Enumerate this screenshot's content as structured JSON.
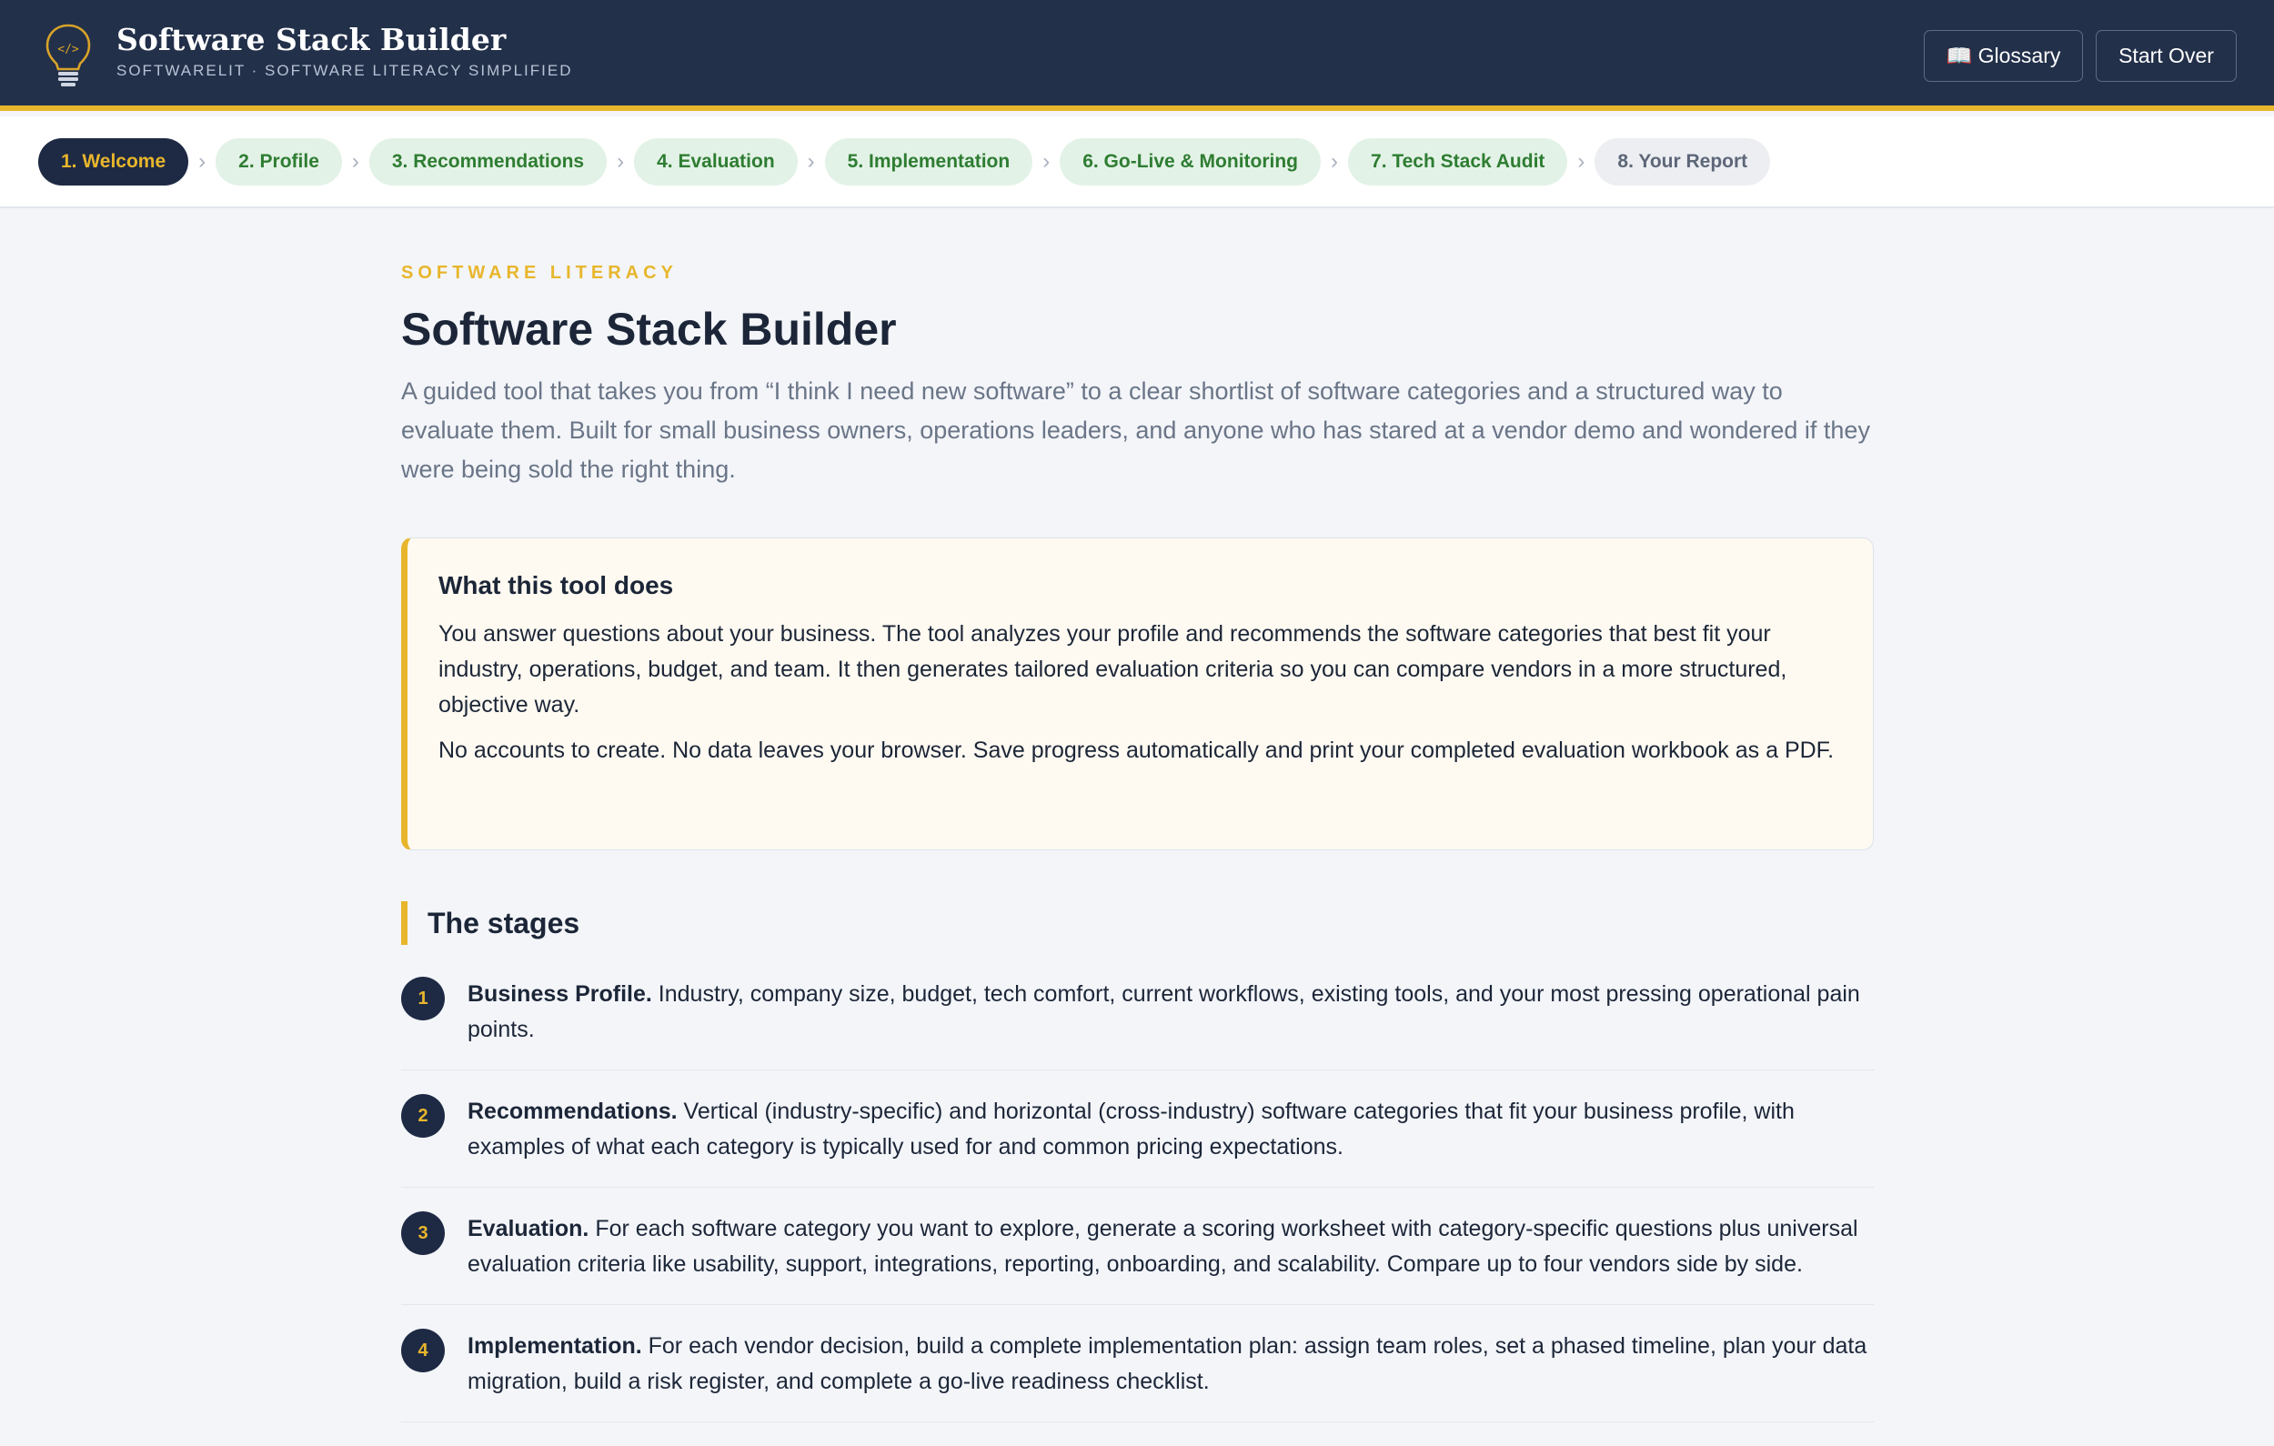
{
  "header": {
    "title": "Software Stack Builder",
    "subtitle": "SOFTWARELIT · SOFTWARE LITERACY SIMPLIFIED",
    "glossary_label": "📖 Glossary",
    "start_over_label": "Start Over",
    "accent_color": "#e8b62c",
    "bar_color": "#22304a"
  },
  "steps": [
    {
      "label": "1. Welcome",
      "state": "active"
    },
    {
      "label": "2. Profile",
      "state": "done"
    },
    {
      "label": "3. Recommendations",
      "state": "done"
    },
    {
      "label": "4. Evaluation",
      "state": "done"
    },
    {
      "label": "5. Implementation",
      "state": "done"
    },
    {
      "label": "6. Go-Live & Monitoring",
      "state": "done"
    },
    {
      "label": "7. Tech Stack Audit",
      "state": "done"
    },
    {
      "label": "8. Your Report",
      "state": "locked"
    }
  ],
  "main": {
    "kicker": "SOFTWARE LITERACY",
    "title": "Software Stack Builder",
    "intro": "A guided tool that takes you from “I think I need new software” to a clear shortlist of software categories and a structured way to evaluate them. Built for small business owners, operations leaders, and anyone who has stared at a vendor demo and wondered if they were being sold the right thing.",
    "callout": {
      "title": "What this tool does",
      "p1": "You answer questions about your business. The tool analyzes your profile and recommends the software categories that best fit your industry, operations, budget, and team. It then generates tailored evaluation criteria so you can compare vendors in a more structured, objective way.",
      "p2": "No accounts to create. No data leaves your browser. Save progress automatically and print your completed evaluation workbook as a PDF."
    },
    "stages_heading": "The stages",
    "stages": [
      {
        "num": "1",
        "title": "Business Profile.",
        "text": " Industry, company size, budget, tech comfort, current workflows, existing tools, and your most pressing operational pain points."
      },
      {
        "num": "2",
        "title": "Recommendations.",
        "text": " Vertical (industry-specific) and horizontal (cross-industry) software categories that fit your business profile, with examples of what each category is typically used for and common pricing expectations."
      },
      {
        "num": "3",
        "title": "Evaluation.",
        "text": " For each software category you want to explore, generate a scoring worksheet with category-specific questions plus universal evaluation criteria like usability, support, integrations, reporting, onboarding, and scalability. Compare up to four vendors side by side."
      },
      {
        "num": "4",
        "title": "Implementation.",
        "text": " For each vendor decision, build a complete implementation plan: assign team roles, set a phased timeline, plan your data migration, build a risk register, and complete a go-live readiness checklist."
      }
    ]
  }
}
